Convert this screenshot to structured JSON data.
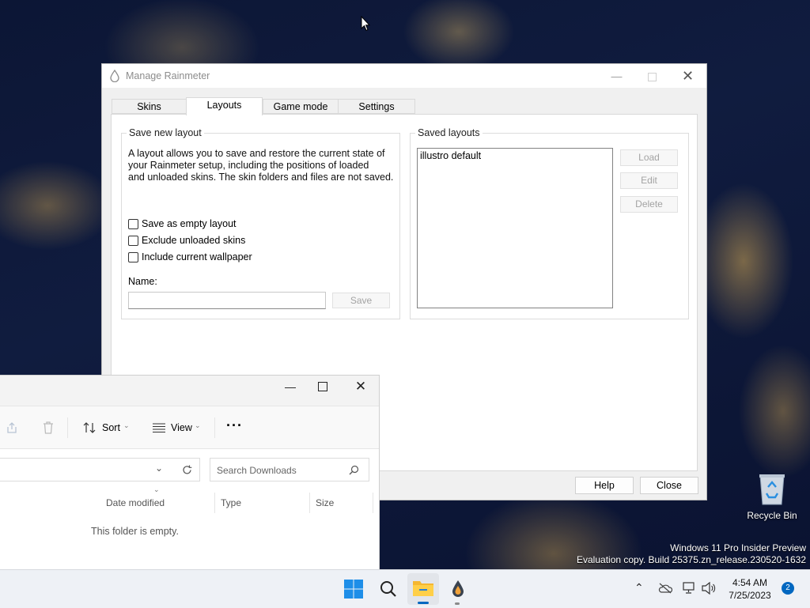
{
  "rainmeter": {
    "title": "Manage Rainmeter",
    "tabs": [
      {
        "label": "Skins"
      },
      {
        "label": "Layouts"
      },
      {
        "label": "Game mode"
      },
      {
        "label": "Settings"
      }
    ],
    "active_tab": "Layouts",
    "save_group": {
      "label": "Save new layout",
      "description_lines": [
        "A layout allows you to save and restore the current state of",
        "your Rainmeter setup, including the positions of loaded",
        "and unloaded skins. The skin folders and files are not saved."
      ],
      "checkboxes": [
        {
          "label": "Save as empty layout",
          "checked": false
        },
        {
          "label": "Exclude unloaded skins",
          "checked": false
        },
        {
          "label": "Include current wallpaper",
          "checked": false
        }
      ],
      "name_label": "Name:",
      "name_value": "",
      "save_label": "Save"
    },
    "saved_group": {
      "label": "Saved layouts",
      "items": [
        "illustro default"
      ],
      "load_label": "Load",
      "edit_label": "Edit",
      "delete_label": "Delete"
    },
    "help_label": "Help",
    "close_label": "Close"
  },
  "explorer": {
    "sort_label": "Sort",
    "view_label": "View",
    "more_label": "···",
    "search_placeholder": "Search Downloads",
    "columns": [
      "Date modified",
      "Type",
      "Size"
    ],
    "empty_text": "This folder is empty."
  },
  "desktop": {
    "recycle_bin_label": "Recycle Bin",
    "watermark_line1": "Windows 11 Pro Insider Preview",
    "watermark_line2": "Evaluation copy. Build 25375.zn_release.230520-1632"
  },
  "taskbar": {
    "time": "4:54 AM",
    "date": "7/25/2023",
    "notification_count": "2"
  },
  "colors": {
    "accent": "#0067c0",
    "windows_blue": "#1e8ee8",
    "explorer_folder": "#f5b731"
  }
}
